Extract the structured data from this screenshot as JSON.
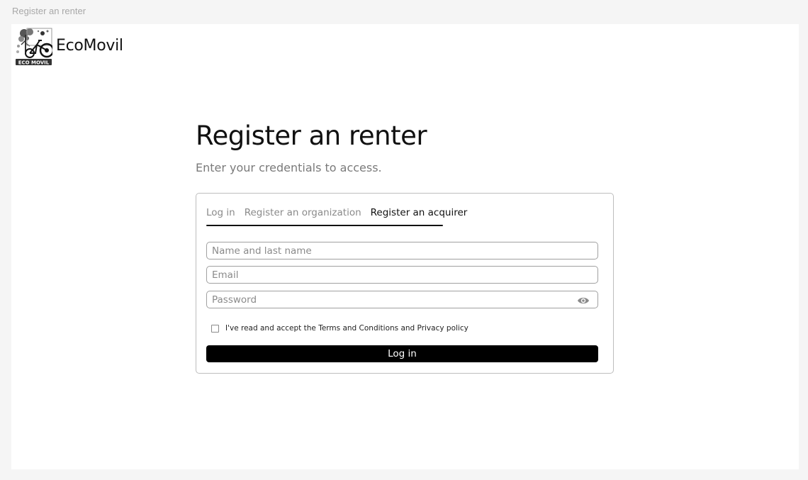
{
  "frame": {
    "label": "Register an renter"
  },
  "brand": {
    "name": "EcoMovil",
    "badge_text": "ECO MOVIL"
  },
  "header": {
    "title": "Register an renter",
    "subtitle": "Enter your credentials to access."
  },
  "tabs": [
    {
      "label": "Log in",
      "active": false
    },
    {
      "label": "Register an organization",
      "active": false
    },
    {
      "label": "Register an acquirer",
      "active": true
    }
  ],
  "form": {
    "name_placeholder": "Name and last name",
    "name_value": "",
    "email_placeholder": "Email",
    "email_value": "",
    "password_placeholder": "Password",
    "password_value": "",
    "password_toggle_icon": "eye-icon",
    "terms_label": "I've read and accept the Terms and Conditions and Privacy policy",
    "terms_checked": false,
    "submit_label": "Log in"
  },
  "colors": {
    "primary_button": "#000000",
    "page_background": "#f5f5f5",
    "canvas_background": "#ffffff",
    "muted_text": "#8a8a8a"
  }
}
